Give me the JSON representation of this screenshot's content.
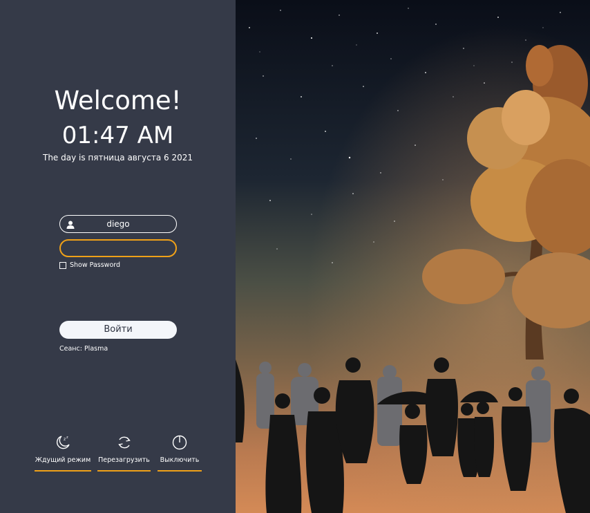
{
  "greeting": "Welcome!",
  "clock": "01:47 AM",
  "date_line": "The day is пятница августа 6 2021",
  "login": {
    "username": "diego",
    "password_value": "",
    "show_password_label": "Show Password",
    "login_button": "Войти",
    "session_label": "Сеанс: Plasma"
  },
  "power": {
    "sleep": {
      "label": "Ждущий режим",
      "icon": "sleep-icon"
    },
    "reboot": {
      "label": "Перезагрузить",
      "icon": "reboot-icon"
    },
    "shutdown": {
      "label": "Выключить",
      "icon": "power-icon"
    }
  },
  "colors": {
    "panel": "#353a48",
    "accent": "#f0a118",
    "button_bg": "#f4f6fa"
  }
}
